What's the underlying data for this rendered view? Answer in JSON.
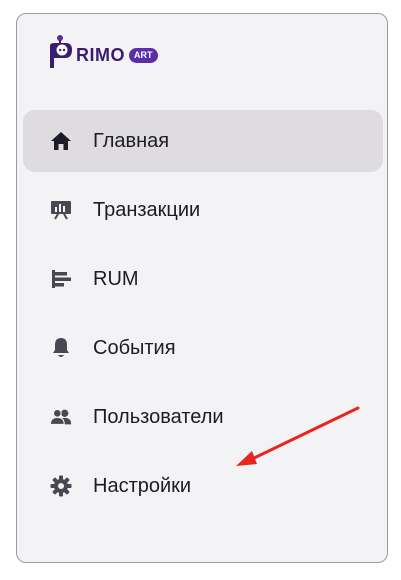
{
  "logo": {
    "text": "RIMO",
    "badge": "ART"
  },
  "nav": {
    "items": [
      {
        "label": "Главная",
        "icon": "home-icon",
        "active": true
      },
      {
        "label": "Транзакции",
        "icon": "presentation-chart-icon",
        "active": false
      },
      {
        "label": "RUM",
        "icon": "bars-icon",
        "active": false
      },
      {
        "label": "События",
        "icon": "bell-icon",
        "active": false
      },
      {
        "label": "Пользователи",
        "icon": "users-icon",
        "active": false
      },
      {
        "label": "Настройки",
        "icon": "gear-icon",
        "active": false
      }
    ]
  },
  "colors": {
    "accent": "#3a1c71",
    "badge": "#5a2ea6",
    "active_bg": "#dedcdf",
    "annotation_arrow": "#e8251f"
  }
}
